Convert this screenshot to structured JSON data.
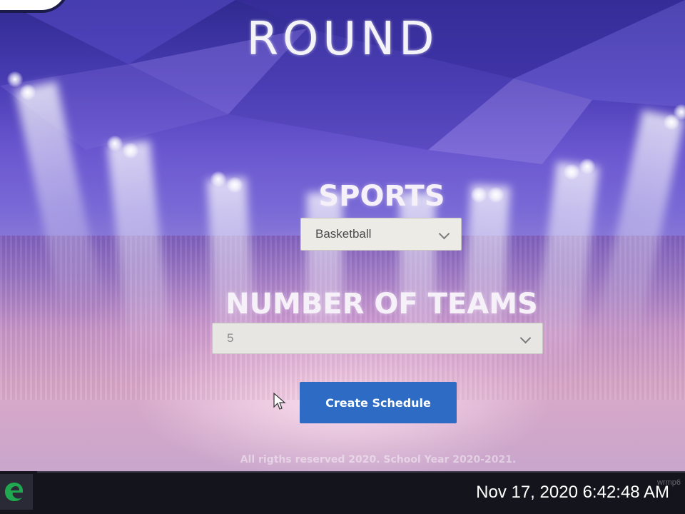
{
  "app": {
    "title": "ROUND"
  },
  "form": {
    "sports_label": "SPORTS",
    "sports_value": "Basketball",
    "teams_label": "NUMBER OF TEAMS",
    "teams_value": "5",
    "create_label": "Create Schedule"
  },
  "footer": {
    "text": "All rigths reserved 2020. School Year 2020-2021."
  },
  "taskbar": {
    "timestamp": "Nov 17, 2020 6:42:48 AM",
    "watermark": "wrmp6"
  },
  "colors": {
    "button": "#2d6bc4",
    "taskbar": "#14141c",
    "edge_icon": "#1fa84f"
  },
  "icons": [
    "edge-browser-icon",
    "chevron-down-icon",
    "mouse-cursor-icon"
  ]
}
